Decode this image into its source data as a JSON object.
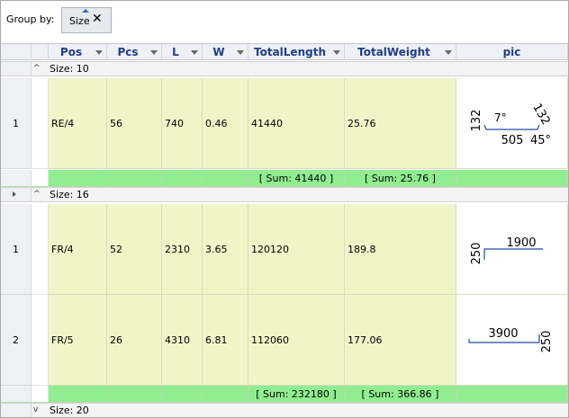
{
  "group_panel": {
    "label": "Group by:",
    "chip_label": "Size",
    "chip_close": "✕"
  },
  "columns": [
    "Pos",
    "Pcs",
    "L",
    "W",
    "TotalLength",
    "TotalWeight",
    "pic"
  ],
  "groups": [
    {
      "label": "Size: 10",
      "expander": "^",
      "rows": [
        {
          "num": "1",
          "pos": "RE/4",
          "pcs": "56",
          "l": "740",
          "w": "0.46",
          "total_length": "41440",
          "total_weight": "25.76",
          "pic": {
            "left": "132",
            "angle_left": "7°",
            "bottom": "505",
            "right": "132",
            "angle_right": "45°"
          }
        }
      ],
      "sum_length": "[ Sum: 41440 ]",
      "sum_weight": "[ Sum: 25.76 ]"
    },
    {
      "label": "Size: 16",
      "expander": "^",
      "rows": [
        {
          "num": "1",
          "pos": "FR/4",
          "pcs": "52",
          "l": "2310",
          "w": "3.65",
          "total_length": "120120",
          "total_weight": "189.8",
          "pic": {
            "left": "250",
            "top": "1900"
          }
        },
        {
          "num": "2",
          "pos": "FR/5",
          "pcs": "26",
          "l": "4310",
          "w": "6.81",
          "total_length": "112060",
          "total_weight": "177.06",
          "pic": {
            "top": "3900",
            "right": "250"
          }
        }
      ],
      "sum_length": "[ Sum: 232180 ]",
      "sum_weight": "[ Sum: 366.86 ]"
    },
    {
      "label": "Size: 20",
      "expander": "v"
    }
  ],
  "colors": {
    "cell_bg": "#f0f5c8",
    "sum_bg": "#90ee90",
    "header_text": "#1f3f8a",
    "drawing": "#1f4ea8"
  }
}
